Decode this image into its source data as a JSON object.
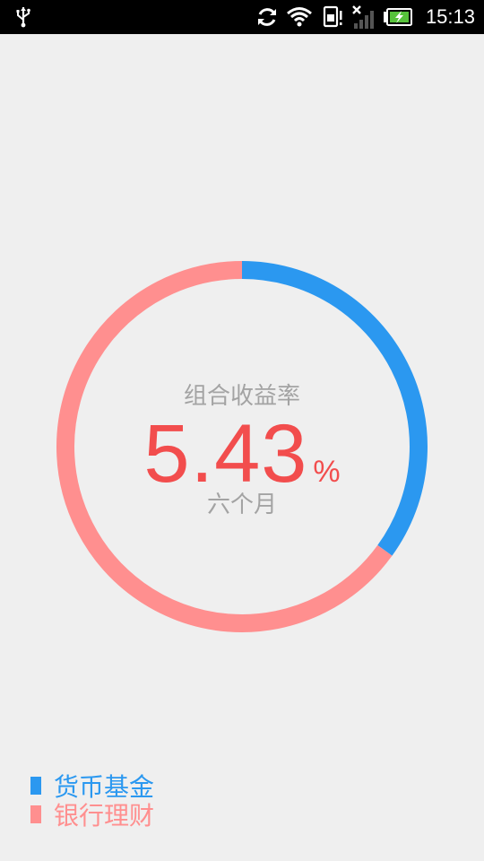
{
  "status_bar": {
    "time": "15:13",
    "icons": [
      "usb-icon",
      "sync-icon",
      "wifi-icon",
      "sim-icon",
      "signal-icon",
      "battery-charging-icon"
    ]
  },
  "summary": {
    "title": "组合收益率",
    "value": "5.43",
    "unit": "%",
    "period": "六个月"
  },
  "colors": {
    "fund": "#2b98f0",
    "bank": "#ff8f8f",
    "rate": "#f24d4d",
    "label": "#a3a3a3"
  },
  "chart_data": {
    "type": "pie",
    "series": [
      {
        "name": "货币基金",
        "value": 35
      },
      {
        "name": "银行理财",
        "value": 65
      }
    ]
  },
  "legend": {
    "items": [
      {
        "label": "货币基金",
        "color": "#2b98f0"
      },
      {
        "label": "银行理财",
        "color": "#ff8f8f"
      }
    ]
  }
}
